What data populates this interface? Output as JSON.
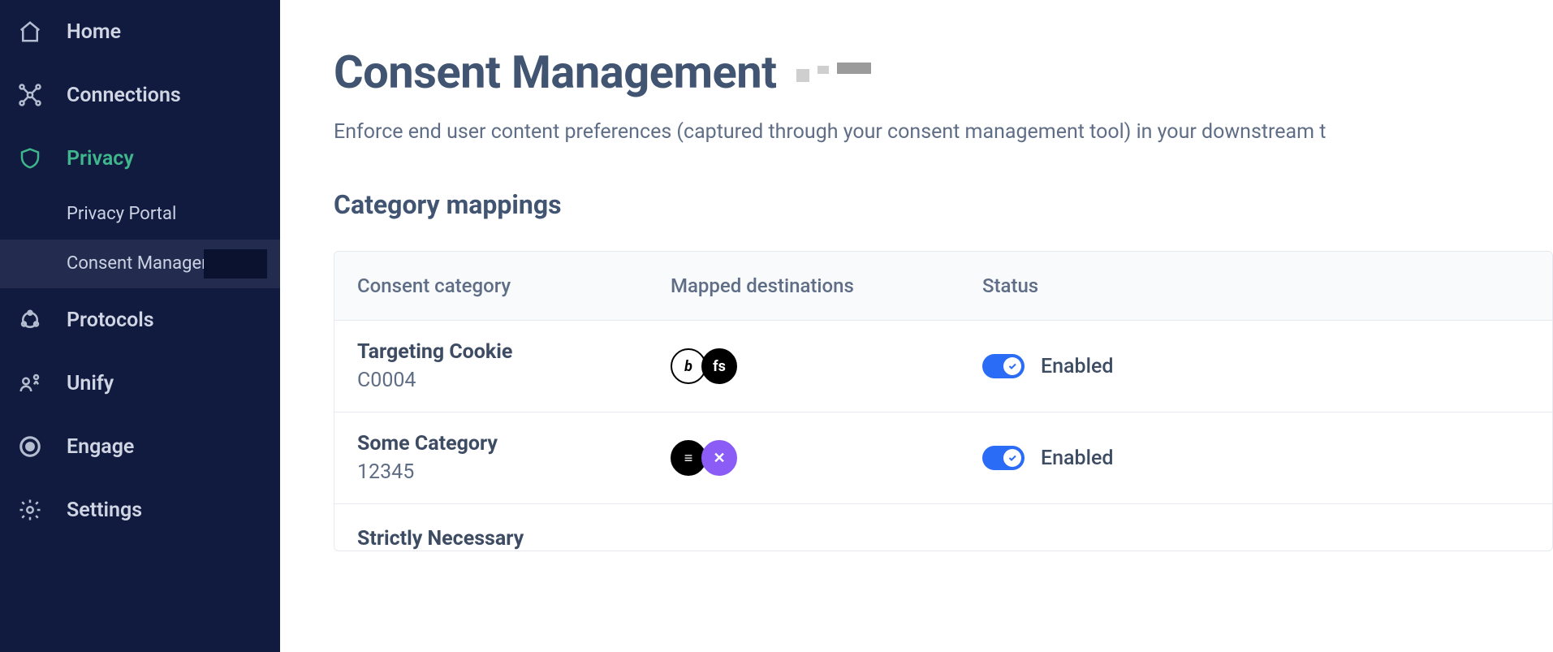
{
  "sidebar": {
    "items": [
      {
        "label": "Home",
        "icon": "home-icon"
      },
      {
        "label": "Connections",
        "icon": "connections-icon"
      },
      {
        "label": "Privacy",
        "icon": "shield-icon",
        "active": true,
        "children": [
          {
            "label": "Privacy Portal"
          },
          {
            "label": "Consent Management",
            "active": true
          }
        ]
      },
      {
        "label": "Protocols",
        "icon": "protocols-icon"
      },
      {
        "label": "Unify",
        "icon": "unify-icon"
      },
      {
        "label": "Engage",
        "icon": "engage-icon"
      },
      {
        "label": "Settings",
        "icon": "gear-icon"
      }
    ]
  },
  "page": {
    "title": "Consent Management",
    "subtitle": "Enforce end user content preferences (captured through your consent management tool) in your downstream t",
    "section": "Category mappings"
  },
  "table": {
    "headers": {
      "category": "Consent category",
      "destinations": "Mapped destinations",
      "status": "Status"
    },
    "rows": [
      {
        "name": "Targeting Cookie",
        "id": "C0004",
        "destinations": [
          {
            "label": "b",
            "bg": "#ffffff",
            "fg": "#000000",
            "border": "#000000",
            "italic": true
          },
          {
            "label": "fs",
            "bg": "#000000",
            "fg": "#ffffff",
            "border": "#000000"
          }
        ],
        "status": {
          "enabled": true,
          "label": "Enabled"
        }
      },
      {
        "name": "Some Category",
        "id": "12345",
        "destinations": [
          {
            "label": "≡",
            "bg": "#000000",
            "fg": "#ffffff",
            "border": "#000000"
          },
          {
            "label": "✕",
            "bg": "#8b5cf6",
            "fg": "#ffffff",
            "border": "#8b5cf6"
          }
        ],
        "status": {
          "enabled": true,
          "label": "Enabled"
        }
      }
    ],
    "partial_row": {
      "name": "Strictly Necessary"
    }
  }
}
